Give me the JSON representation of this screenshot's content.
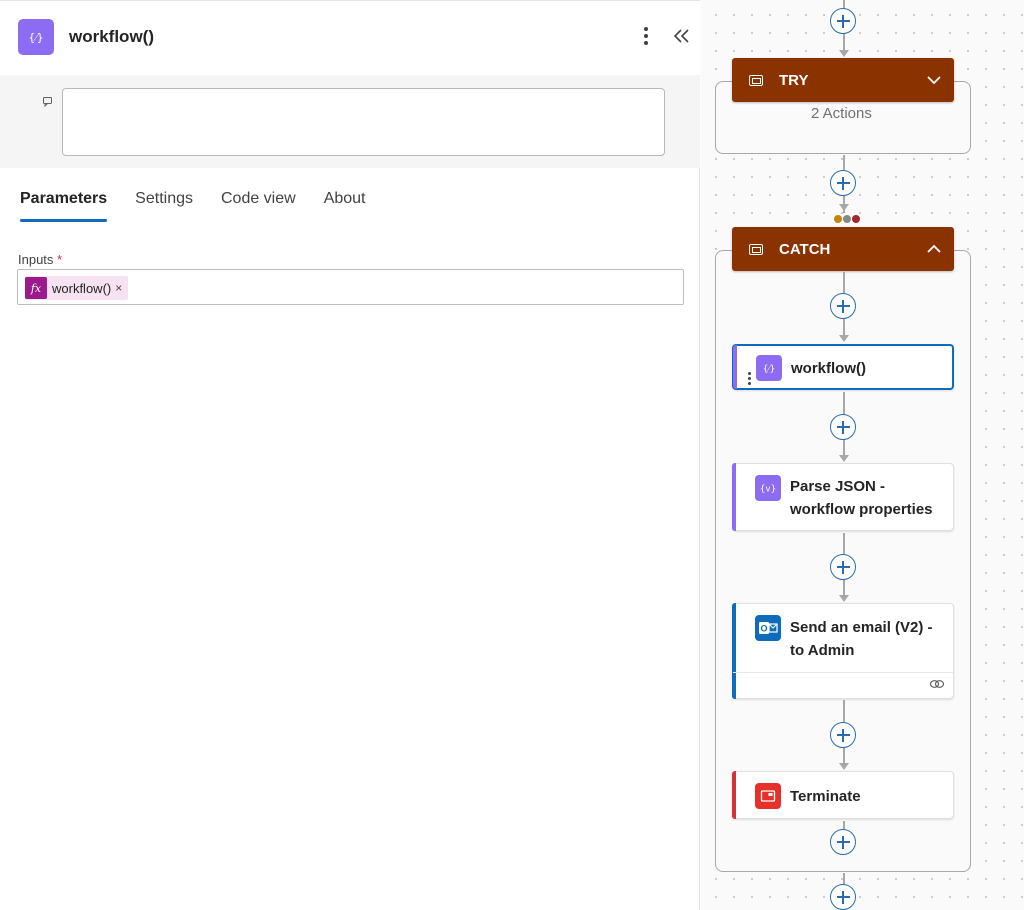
{
  "panel": {
    "title": "workflow()",
    "icon": "expression-icon",
    "description_value": "",
    "tabs": [
      {
        "label": "Parameters",
        "active": true
      },
      {
        "label": "Settings",
        "active": false
      },
      {
        "label": "Code view",
        "active": false
      },
      {
        "label": "About",
        "active": false
      }
    ],
    "inputs_label": "Inputs",
    "required_marker": "*",
    "token": {
      "icon_text": "fx",
      "text": "workflow()",
      "remove": "×"
    }
  },
  "canvas": {
    "try_scope": {
      "title": "TRY",
      "count_text": "2 Actions",
      "color": "#8b3300"
    },
    "catch_scope": {
      "title": "CATCH",
      "color": "#8b3300"
    },
    "run_after_colors": [
      "#c5840d",
      "#8a8886",
      "#a4262c"
    ],
    "actions": [
      {
        "title": "workflow()",
        "icon": "expression-icon",
        "accent": "#8c6cf3",
        "selected": true
      },
      {
        "title_line1": "Parse JSON -",
        "title_line2": "workflow properties",
        "icon": "parse-json-icon",
        "accent": "#8c6cf3"
      },
      {
        "title_line1": "Send an email (V2) -",
        "title_line2": "to Admin",
        "icon": "outlook-icon",
        "accent": "#0f6cbd",
        "footer_icon": "link-icon"
      },
      {
        "title": "Terminate",
        "icon": "terminate-icon",
        "accent": "#d13438"
      }
    ]
  }
}
